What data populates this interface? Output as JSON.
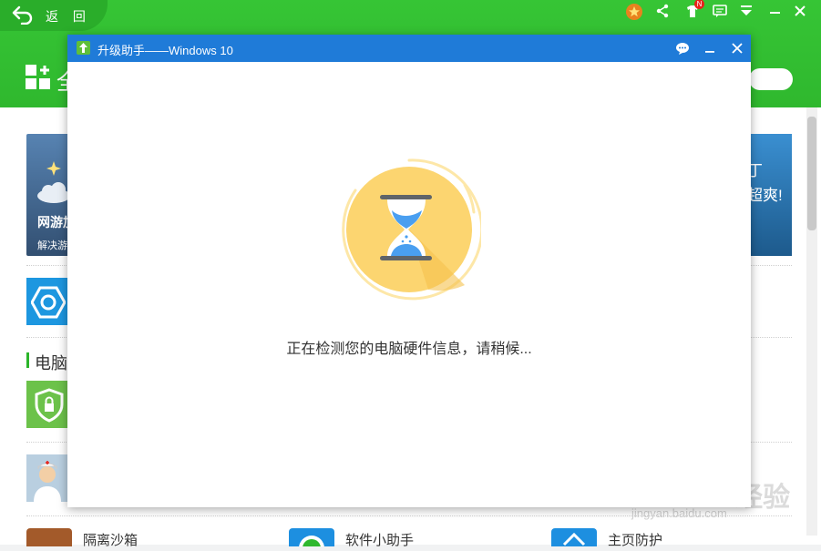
{
  "app": {
    "back_label": "返 回",
    "header_title": "全",
    "top_icons": [
      "medal-icon",
      "share-icon",
      "notification-shirt-icon",
      "message-icon",
      "menu-down-icon",
      "minimize-icon",
      "close-icon"
    ],
    "notification_badge": "N"
  },
  "background": {
    "banner_left_title": "网游加",
    "banner_left_sub": "解决游",
    "banner_right_line1": "丁",
    "banner_right_line2": "超爽!",
    "section_title": "电脑",
    "bottom_items": [
      {
        "label": "隔离沙箱"
      },
      {
        "label": "软件小助手"
      },
      {
        "label": "主页防护"
      }
    ],
    "watermark_main": "Bai du 经验",
    "watermark_sub": "jingyan.baidu.com"
  },
  "dialog": {
    "title": "升级助手——Windows 10",
    "status_text": "正在检测您的电脑硬件信息，请稍候...",
    "icon_name": "upgrade-arrow-icon",
    "colors": {
      "titlebar": "#1f7bd8",
      "hourglass_circle": "#fcd570",
      "accent_green": "#36c535"
    }
  }
}
